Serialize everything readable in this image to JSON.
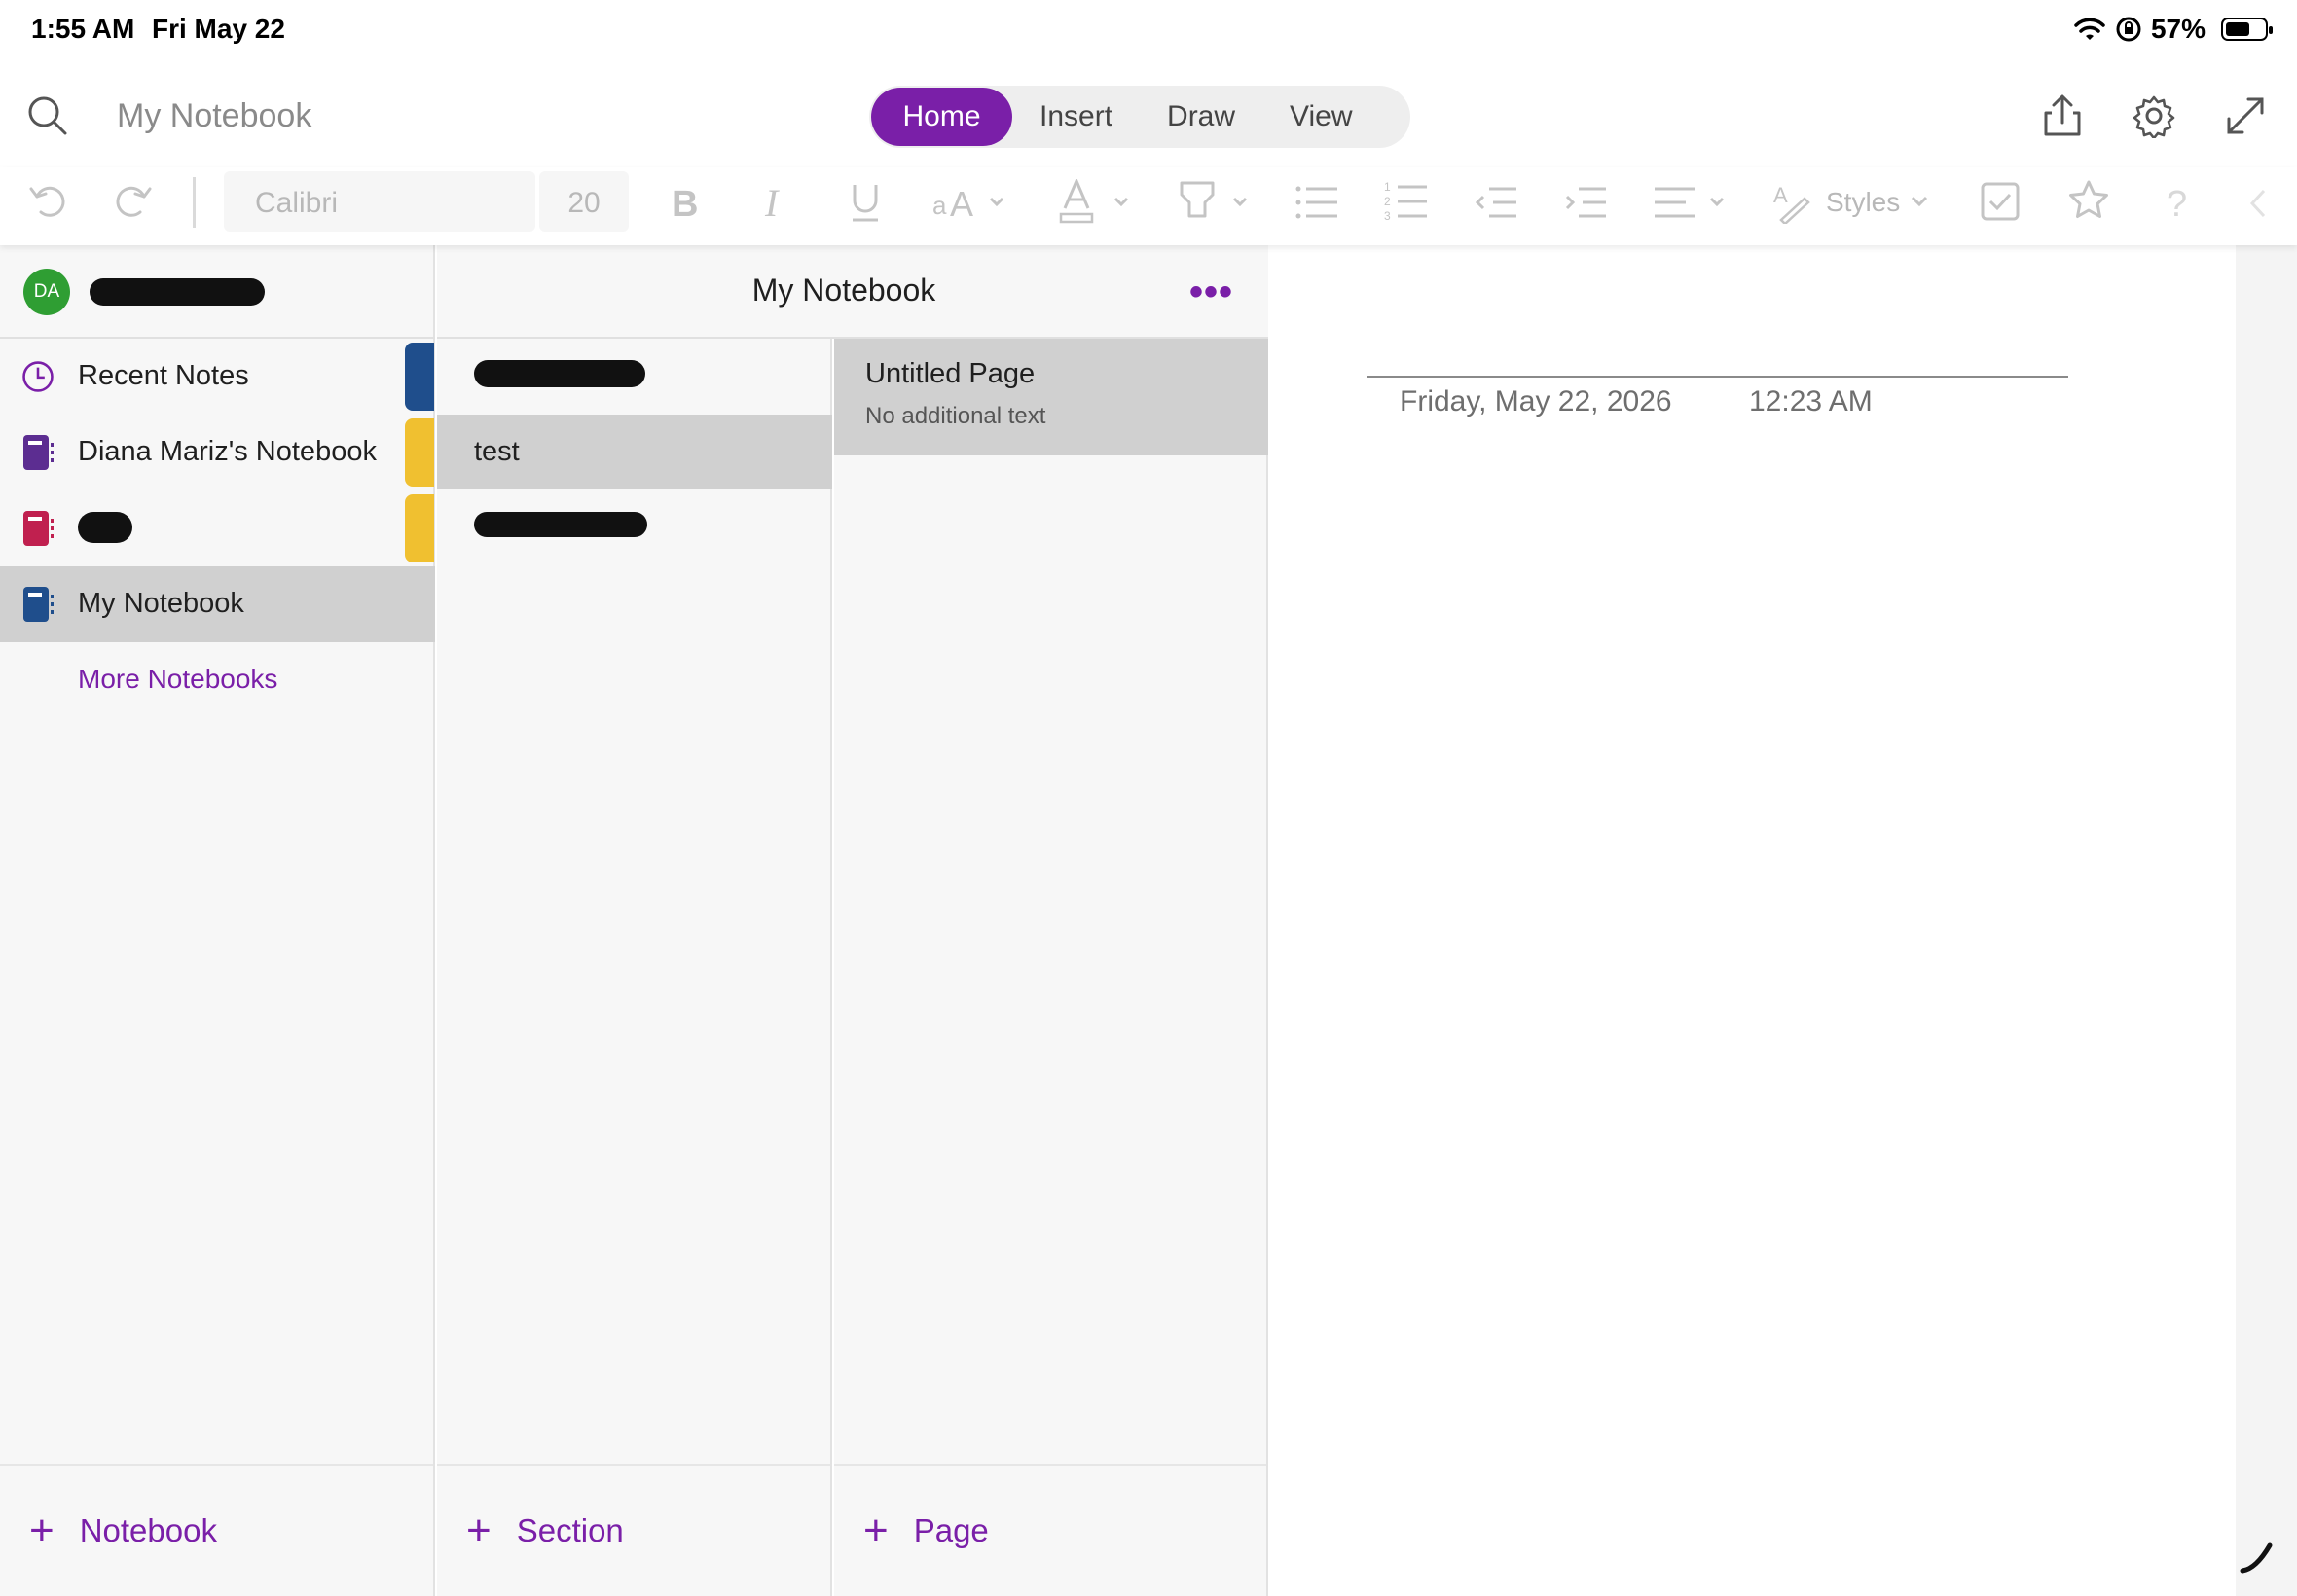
{
  "status_bar": {
    "time": "1:55 AM",
    "date": "Fri May 22",
    "battery": "57%"
  },
  "topbar": {
    "notebook_title": "My Notebook",
    "tabs": [
      {
        "label": "Home",
        "active": true
      },
      {
        "label": "Insert",
        "active": false
      },
      {
        "label": "Draw",
        "active": false
      },
      {
        "label": "View",
        "active": false
      }
    ]
  },
  "ribbon": {
    "font": "Calibri",
    "size": "20",
    "styles": "Styles"
  },
  "account": {
    "initials": "DA"
  },
  "notebooks": {
    "items": [
      {
        "label": "Recent Notes"
      },
      {
        "label": "Diana Mariz's Notebook"
      },
      {
        "label": ""
      },
      {
        "label": "My Notebook"
      }
    ],
    "more": "More Notebooks",
    "add_label": "Notebook"
  },
  "sections": {
    "header": "My Notebook",
    "items": [
      {
        "label": ""
      },
      {
        "label": "test"
      },
      {
        "label": ""
      }
    ],
    "add_label": "Section"
  },
  "pages": {
    "items": [
      {
        "title": "Untitled Page",
        "preview": "No additional text"
      }
    ],
    "add_label": "Page"
  },
  "canvas": {
    "date": "Friday, May 22, 2026",
    "time": "12:23 AM"
  },
  "colors": {
    "accent": "#7a1fa8",
    "recent_tab": "#1f4e8c",
    "diana_tab": "#f0c030",
    "third_tab": "#f0c030",
    "mynotebook_icon": "#1f4e8c",
    "diana_icon": "#5c2d91",
    "third_icon": "#c0204f",
    "avatar": "#2f9e33"
  }
}
